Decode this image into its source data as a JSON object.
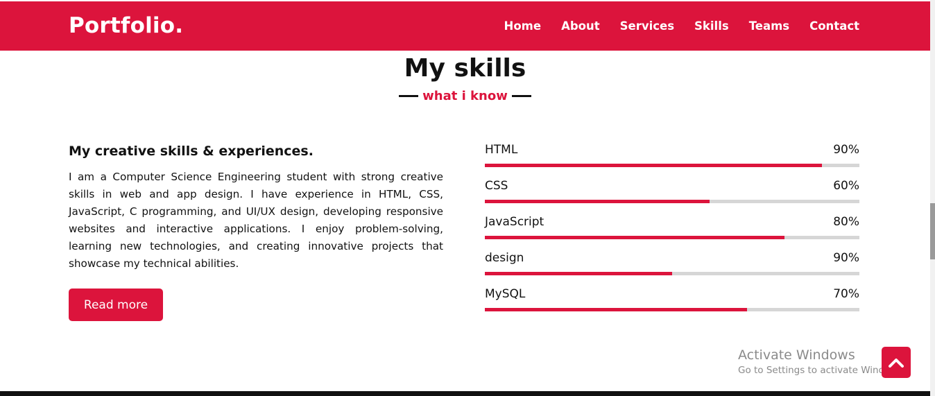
{
  "nav": {
    "logo": "Portfolio.",
    "links": [
      "Home",
      "About",
      "Services",
      "Skills",
      "Teams",
      "Contact"
    ]
  },
  "section": {
    "title": "My skills",
    "subtitle": "what i know"
  },
  "about": {
    "heading": "My creative skills & experiences.",
    "text": "I am a Computer Science Engineering student with strong creative skills in web and app design. I have experience in HTML, CSS, JavaScript, C programming, and UI/UX design, developing responsive websites and interactive applications. I enjoy problem-solving, learning new technologies, and creating innovative projects that showcase my technical abilities.",
    "button": "Read more"
  },
  "skills": [
    {
      "name": "HTML",
      "percent_label": "90%",
      "bar_fill": 0.9
    },
    {
      "name": "CSS",
      "percent_label": "60%",
      "bar_fill": 0.6
    },
    {
      "name": "JavaScript",
      "percent_label": "80%",
      "bar_fill": 0.8
    },
    {
      "name": "design",
      "percent_label": "90%",
      "bar_fill": 0.5
    },
    {
      "name": "MySQL",
      "percent_label": "70%",
      "bar_fill": 0.7
    }
  ],
  "watermark": {
    "title": "Activate Windows",
    "subtitle": "Go to Settings to activate Windows."
  },
  "icons": {
    "scroll_top": "chevron-up-icon"
  },
  "colors": {
    "accent": "#dc143c",
    "track": "#d6d6d6",
    "text": "#111111"
  }
}
